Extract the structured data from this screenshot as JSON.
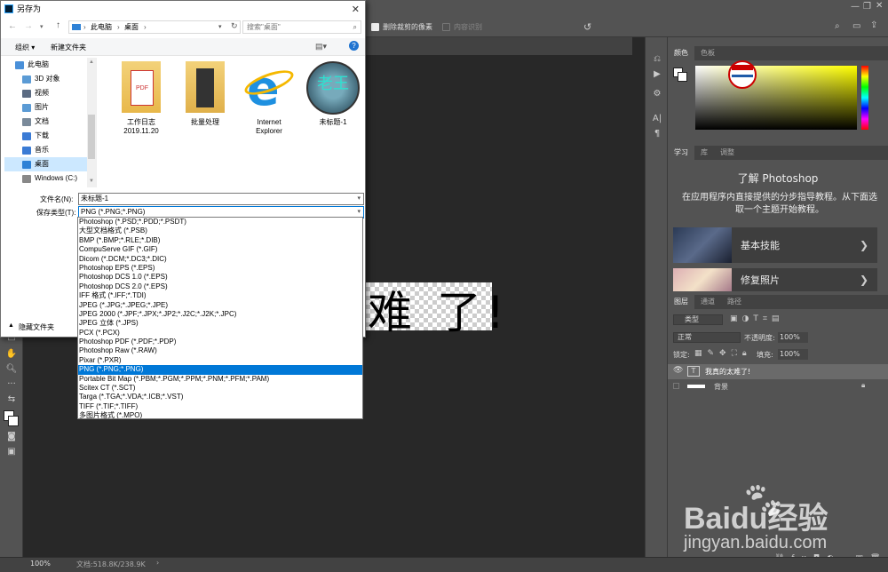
{
  "dialog": {
    "title": "另存为",
    "breadcrumb": [
      "此电脑",
      "桌面"
    ],
    "search_placeholder": "搜索\"桌面\"",
    "toolbar": {
      "organize": "组织 ▾",
      "new_folder": "新建文件夹"
    },
    "nav": [
      {
        "label": "此电脑",
        "icon": "computer-icon",
        "color": "#4a90d9"
      },
      {
        "label": "3D 对象",
        "icon": "cube-icon",
        "color": "#5b9bd5"
      },
      {
        "label": "视频",
        "icon": "video-icon",
        "color": "#5b6b82"
      },
      {
        "label": "图片",
        "icon": "picture-icon",
        "color": "#5b9bd5"
      },
      {
        "label": "文档",
        "icon": "document-icon",
        "color": "#7a8a9a"
      },
      {
        "label": "下载",
        "icon": "download-icon",
        "color": "#3a7bd5"
      },
      {
        "label": "音乐",
        "icon": "music-icon",
        "color": "#3a7bd5"
      },
      {
        "label": "桌面",
        "icon": "desktop-icon",
        "color": "#2f82d6",
        "selected": true
      },
      {
        "label": "Windows (C:)",
        "icon": "drive-icon",
        "color": "#888"
      }
    ],
    "files": [
      {
        "label": "工作日志\n2019.11.20",
        "icon": "pdf-folder-icon"
      },
      {
        "label": "批量处理",
        "icon": "folder-icon"
      },
      {
        "label": "Internet\nExplorer",
        "icon": "ie-icon"
      },
      {
        "label": "未标题-1",
        "icon": "image-thumb-icon"
      }
    ],
    "filename_label": "文件名(N):",
    "filename_value": "未标题-1",
    "filetype_label": "保存类型(T):",
    "filetype_value": "PNG (*.PNG;*.PNG)",
    "hide_folders": "隐藏文件夹",
    "filetype_options": [
      "Photoshop (*.PSD;*.PDD;*.PSDT)",
      "大型文档格式 (*.PSB)",
      "BMP (*.BMP;*.RLE;*.DIB)",
      "CompuServe GIF (*.GIF)",
      "Dicom (*.DCM;*.DC3;*.DIC)",
      "Photoshop EPS (*.EPS)",
      "Photoshop DCS 1.0 (*.EPS)",
      "Photoshop DCS 2.0 (*.EPS)",
      "IFF 格式 (*.IFF;*.TDI)",
      "JPEG (*.JPG;*.JPEG;*.JPE)",
      "JPEG 2000 (*.JPF;*.JPX;*.JP2;*.J2C;*.J2K;*.JPC)",
      "JPEG 立体 (*.JPS)",
      "PCX (*.PCX)",
      "Photoshop PDF (*.PDF;*.PDP)",
      "Photoshop Raw (*.RAW)",
      "Pixar (*.PXR)",
      "PNG (*.PNG;*.PNG)",
      "Portable Bit Map (*.PBM;*.PGM;*.PPM;*.PNM;*.PFM;*.PAM)",
      "Scitex CT (*.SCT)",
      "Targa (*.TGA;*.VDA;*.ICB;*.VST)",
      "TIFF (*.TIF;*.TIFF)",
      "多图片格式 (*.MPO)"
    ],
    "selected_option": 16
  },
  "photoshop": {
    "options_bar": {
      "delete_cropped": "删除裁剪的像素",
      "content_aware": "内容识别"
    },
    "canvas_text": "难 了!",
    "color_panel": {
      "tabs": [
        "颜色",
        "色板"
      ]
    },
    "learn_panel": {
      "tabs": [
        "学习",
        "库",
        "调整"
      ],
      "heading": "了解 Photoshop",
      "description": "在应用程序内直接提供的分步指导教程。从下面选取一个主题开始教程。",
      "cards": [
        "基本技能",
        "修复照片"
      ]
    },
    "layers_panel": {
      "tabs": [
        "图层",
        "通道",
        "路径"
      ],
      "filter_kind": "类型",
      "blend_mode": "正常",
      "opacity_label": "不透明度:",
      "opacity_value": "100%",
      "lock_label": "锁定:",
      "fill_label": "填充:",
      "fill_value": "100%",
      "layers": [
        {
          "name": "我真的太难了!",
          "type": "text"
        },
        {
          "name": "背景",
          "type": "background"
        }
      ]
    },
    "status": {
      "zoom": "100%",
      "doc": "文档:518.8K/238.9K"
    }
  },
  "watermark": {
    "brand": "Baidu经验",
    "url": "jingyan.baidu.com"
  }
}
